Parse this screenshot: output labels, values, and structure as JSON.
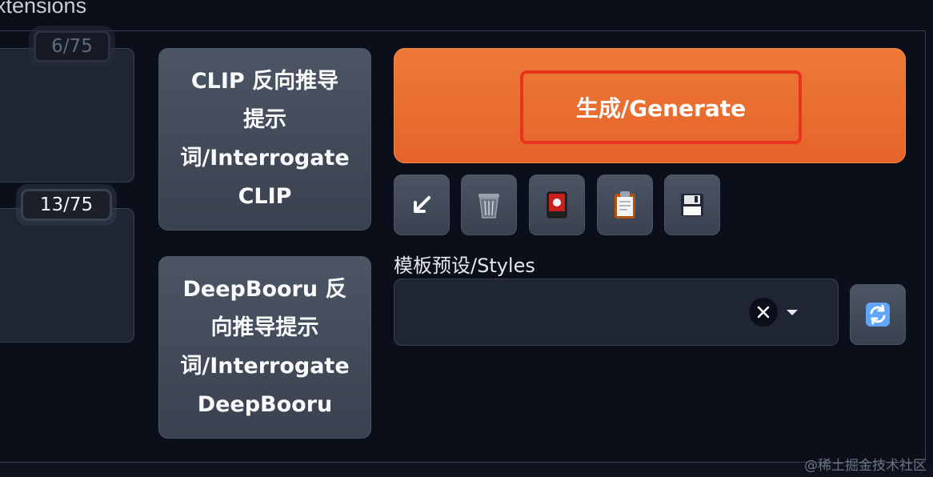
{
  "tab": {
    "title": "xtensions"
  },
  "prompts": {
    "positive_counter": "6/75",
    "negative_counter": "13/75"
  },
  "buttons": {
    "interrogate_clip": [
      "CLIP 反向推导",
      "提示",
      "词/Interrogate",
      "CLIP"
    ],
    "interrogate_deepbooru": [
      "DeepBooru 反",
      "向推导提示",
      "词/Interrogate",
      "DeepBooru"
    ],
    "generate": "生成/Generate"
  },
  "tools": [
    {
      "icon": "arrow-down-left-icon"
    },
    {
      "icon": "trash-icon"
    },
    {
      "icon": "red-card-icon"
    },
    {
      "icon": "clipboard-icon"
    },
    {
      "icon": "save-icon"
    }
  ],
  "styles": {
    "label": "模板预设/Styles",
    "selected": ""
  },
  "watermark": "@稀土掘金技术社区",
  "colors": {
    "generate": "#e9702f",
    "highlight": "#e8341e",
    "background": "#0b0f19"
  }
}
